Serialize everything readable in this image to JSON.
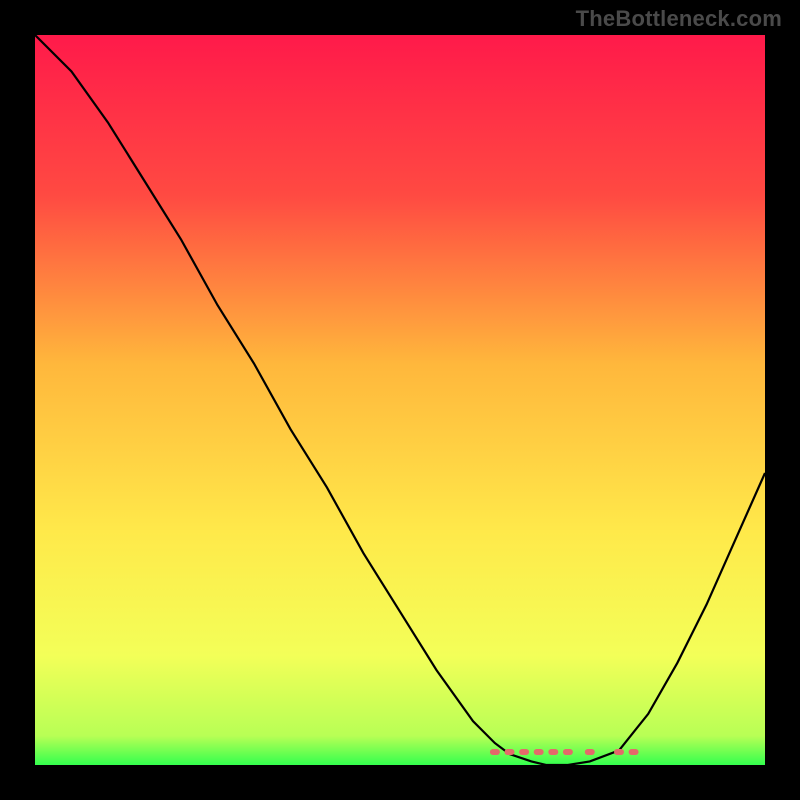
{
  "attribution": "TheBottleneck.com",
  "chart_data": {
    "type": "line",
    "title": "",
    "xlabel": "",
    "ylabel": "",
    "x": [
      0.0,
      0.05,
      0.1,
      0.15,
      0.2,
      0.25,
      0.3,
      0.35,
      0.4,
      0.45,
      0.5,
      0.55,
      0.6,
      0.63,
      0.65,
      0.68,
      0.7,
      0.73,
      0.76,
      0.8,
      0.84,
      0.88,
      0.92,
      0.96,
      1.0
    ],
    "values": [
      1.0,
      0.95,
      0.88,
      0.8,
      0.72,
      0.63,
      0.55,
      0.46,
      0.38,
      0.29,
      0.21,
      0.13,
      0.06,
      0.03,
      0.015,
      0.005,
      0.0,
      0.0,
      0.005,
      0.02,
      0.07,
      0.14,
      0.22,
      0.31,
      0.4
    ],
    "xlim": [
      0,
      1
    ],
    "ylim": [
      0,
      1
    ],
    "style": {
      "background_gradient": [
        "#ff1a4a",
        "#ff6a3a",
        "#ffd23a",
        "#fff85a",
        "#e6ff5c",
        "#3eff52"
      ],
      "line_color": "#000000",
      "bottom_marker_color": "#e46a6a"
    },
    "bottom_markers_x": [
      0.63,
      0.65,
      0.67,
      0.69,
      0.71,
      0.73,
      0.76,
      0.8,
      0.82
    ]
  }
}
